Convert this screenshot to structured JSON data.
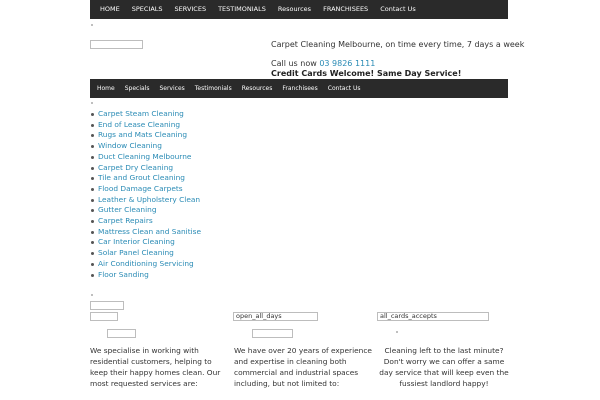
{
  "topnav": {
    "items": [
      "HOME",
      "SPECIALS",
      "SERVICES",
      "TESTIMONIALS",
      "Resources",
      "FRANCHISEES",
      "Contact Us"
    ]
  },
  "header": {
    "tagline": "Carpet Cleaning Melbourne, on time every time, 7 days a week",
    "call_label": "Call us now",
    "phone": "03 9826 1111",
    "promo": "Credit Cards Welcome!  Same Day Service!"
  },
  "mainnav": {
    "items": [
      "Home",
      "Specials",
      "Services",
      "Testimonials",
      "Resources",
      "Franchisees",
      "Contact Us"
    ]
  },
  "services": [
    "Carpet Steam Cleaning",
    "End of Lease Cleaning",
    "Rugs and Mats Cleaning",
    "Window Cleaning",
    "Duct Cleaning Melbourne",
    "Carpet Dry Cleaning",
    "Tile and Grout Cleaning",
    "Flood Damage Carpets",
    "Leather & Upholstery Clean",
    "Gutter Cleaning",
    "Carpet Repairs",
    "Mattress Clean and Sanitise",
    "Car Interior Cleaning",
    "Solar Panel Cleaning",
    "Air Conditioning Servicing",
    "Floor Sanding"
  ],
  "features": {
    "open_label": "open_all_days",
    "cards_label": "all_cards_accepts"
  },
  "columns": [
    "We specialise in working with residential customers, helping to keep their happy homes clean. Our most requested services are:",
    "We have over 20 years of experience and expertise in cleaning both commercial and industrial spaces including, but not limited to:",
    "Cleaning left to the last minute? Don't worry we can offer a same day service that will keep even the fussiest landlord happy!"
  ],
  "colors": {
    "nav_bg": "#2a2a2a",
    "link": "#2a8bb5"
  }
}
